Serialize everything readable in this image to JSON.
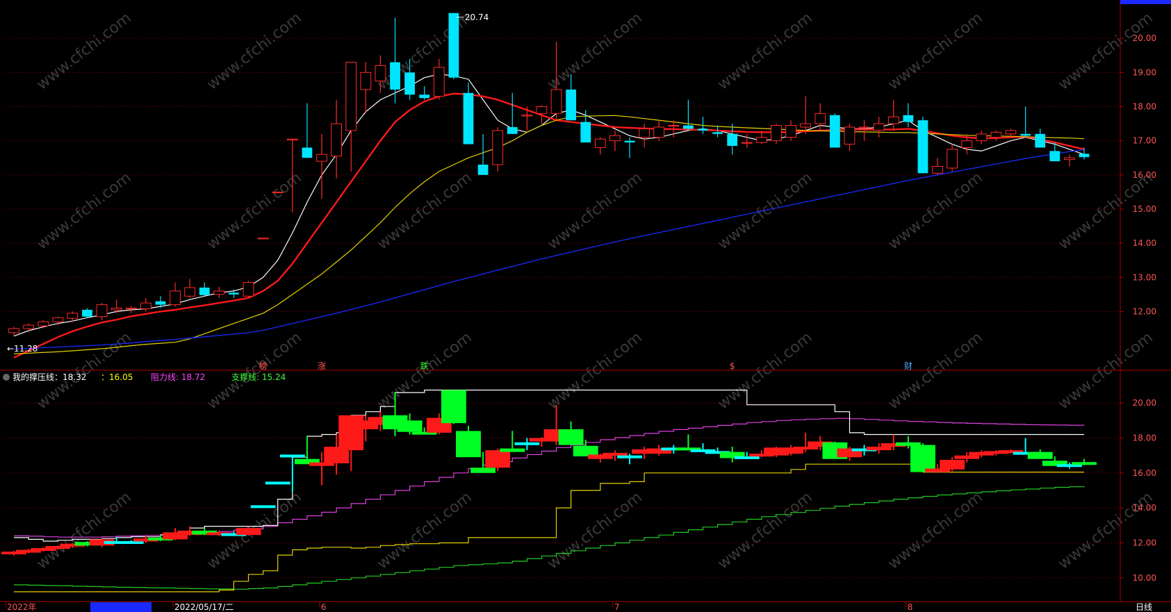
{
  "chart_data": [
    {
      "type": "candlestick",
      "panel": "price",
      "max_label": "20.74",
      "min_label": "11.28",
      "top_right_label": "20.74",
      "y_ticks": [
        "12.00",
        "13.00",
        "14.00",
        "15.00",
        "16.00",
        "17.00",
        "18.00",
        "19.00",
        "20.00"
      ],
      "ylim": [
        10.3,
        21.0
      ],
      "grid": true,
      "colors": {
        "up": "#ff2a2a",
        "down": "#00e5ff",
        "ma5": "#ffffff",
        "ma10": "#ff1a1a",
        "ma20": "#e6d200",
        "ma60": "#1a2aff",
        "grid": "#5a0000",
        "axis": "#aa0000"
      },
      "event_markers": [
        {
          "label": "榜",
          "color": "#ff5555",
          "index": 17
        },
        {
          "label": "涨",
          "color": "#ff5555",
          "index": 21
        },
        {
          "label": "跌",
          "color": "#39ff39",
          "index": 28
        },
        {
          "label": "$",
          "color": "#ff5555",
          "index": 49
        },
        {
          "label": "财",
          "color": "#55aaff",
          "index": 61
        }
      ],
      "candles": [
        [
          11.38,
          11.55,
          11.28,
          11.5
        ],
        [
          11.5,
          11.65,
          11.4,
          11.6
        ],
        [
          11.58,
          11.75,
          11.5,
          11.7
        ],
        [
          11.7,
          11.85,
          11.6,
          11.82
        ],
        [
          11.8,
          12.0,
          11.7,
          11.95
        ],
        [
          12.05,
          12.1,
          11.8,
          11.85
        ],
        [
          11.85,
          12.25,
          11.75,
          12.2
        ],
        [
          12.05,
          12.35,
          11.95,
          12.1
        ],
        [
          12.08,
          12.15,
          11.95,
          12.1
        ],
        [
          12.08,
          12.4,
          12.0,
          12.25
        ],
        [
          12.3,
          12.45,
          12.1,
          12.2
        ],
        [
          12.2,
          12.85,
          12.15,
          12.6
        ],
        [
          12.45,
          12.95,
          12.4,
          12.7
        ],
        [
          12.7,
          12.85,
          12.45,
          12.48
        ],
        [
          12.5,
          12.72,
          12.4,
          12.6
        ],
        [
          12.55,
          12.65,
          12.4,
          12.5
        ],
        [
          12.45,
          12.9,
          12.4,
          12.85
        ],
        [
          14.15,
          14.15,
          14.15,
          14.15
        ],
        [
          15.5,
          15.5,
          15.5,
          15.5
        ],
        [
          17.05,
          17.05,
          14.9,
          17.05
        ],
        [
          16.8,
          18.1,
          16.5,
          16.5
        ],
        [
          16.4,
          17.2,
          15.3,
          16.6
        ],
        [
          16.55,
          18.2,
          15.9,
          17.5
        ],
        [
          17.3,
          19.3,
          16.1,
          19.3
        ],
        [
          18.5,
          19.3,
          17.8,
          19.0
        ],
        [
          18.75,
          19.5,
          18.4,
          19.2
        ],
        [
          19.3,
          20.6,
          18.1,
          18.5
        ],
        [
          19.0,
          19.4,
          18.2,
          18.35
        ],
        [
          18.35,
          18.6,
          18.2,
          18.25
        ],
        [
          18.3,
          19.4,
          18.2,
          19.15
        ],
        [
          20.74,
          20.74,
          18.8,
          18.85
        ],
        [
          18.4,
          18.7,
          16.9,
          16.9
        ],
        [
          16.3,
          17.2,
          16.0,
          16.0
        ],
        [
          16.3,
          17.4,
          16.1,
          17.3
        ],
        [
          17.4,
          18.4,
          17.2,
          17.2
        ],
        [
          17.75,
          18.0,
          17.3,
          17.75
        ],
        [
          17.8,
          18.05,
          17.5,
          18.0
        ],
        [
          17.8,
          19.9,
          17.6,
          18.5
        ],
        [
          18.5,
          18.95,
          17.7,
          17.6
        ],
        [
          17.55,
          17.9,
          17.4,
          16.95
        ],
        [
          16.8,
          17.1,
          16.6,
          17.05
        ],
        [
          17.0,
          17.3,
          16.7,
          17.15
        ],
        [
          17.0,
          17.1,
          16.5,
          16.95
        ],
        [
          17.1,
          17.5,
          16.8,
          17.35
        ],
        [
          17.1,
          17.6,
          17.0,
          17.4
        ],
        [
          17.45,
          17.6,
          17.1,
          17.45
        ],
        [
          17.45,
          18.2,
          17.3,
          17.35
        ],
        [
          17.35,
          17.7,
          17.2,
          17.3
        ],
        [
          17.25,
          17.45,
          17.1,
          17.2
        ],
        [
          17.2,
          17.5,
          16.6,
          16.85
        ],
        [
          16.95,
          17.2,
          16.8,
          16.95
        ],
        [
          16.95,
          17.3,
          16.9,
          17.1
        ],
        [
          17.0,
          17.5,
          16.9,
          17.45
        ],
        [
          17.1,
          17.6,
          17.0,
          17.45
        ],
        [
          17.4,
          18.3,
          17.2,
          17.5
        ],
        [
          17.5,
          18.1,
          17.3,
          17.8
        ],
        [
          17.75,
          17.8,
          16.8,
          16.8
        ],
        [
          16.9,
          17.5,
          16.7,
          17.4
        ],
        [
          17.4,
          17.6,
          17.0,
          17.4
        ],
        [
          17.3,
          17.7,
          17.1,
          17.5
        ],
        [
          17.5,
          18.2,
          17.3,
          17.7
        ],
        [
          17.75,
          18.1,
          17.4,
          17.55
        ],
        [
          17.6,
          17.7,
          16.05,
          16.05
        ],
        [
          16.05,
          16.5,
          16.0,
          16.25
        ],
        [
          16.2,
          16.9,
          16.1,
          16.75
        ],
        [
          16.8,
          17.2,
          16.6,
          17.0
        ],
        [
          17.0,
          17.3,
          16.9,
          17.2
        ],
        [
          17.1,
          17.3,
          17.0,
          17.25
        ],
        [
          17.2,
          17.35,
          17.1,
          17.3
        ],
        [
          17.2,
          18.0,
          17.1,
          17.15
        ],
        [
          17.2,
          17.35,
          16.8,
          16.8
        ],
        [
          16.7,
          16.95,
          16.4,
          16.4
        ],
        [
          16.45,
          16.6,
          16.25,
          16.5
        ],
        [
          16.62,
          16.8,
          16.45,
          16.52
        ]
      ],
      "moving_averages": [
        {
          "name": "MA5",
          "values": [
            11.28,
            11.44,
            11.55,
            11.65,
            11.72,
            11.82,
            11.9,
            12.0,
            12.05,
            12.08,
            12.15,
            12.22,
            12.35,
            12.45,
            12.55,
            12.6,
            12.72,
            13.0,
            13.5,
            14.3,
            15.2,
            16.0,
            16.6,
            17.3,
            17.85,
            18.2,
            18.4,
            18.6,
            18.85,
            18.95,
            18.9,
            18.8,
            18.2,
            17.6,
            17.35,
            17.25,
            17.45,
            17.8,
            17.9,
            17.75,
            17.55,
            17.35,
            17.15,
            17.05,
            17.1,
            17.2,
            17.3,
            17.35,
            17.3,
            17.2,
            17.1,
            17.0,
            17.05,
            17.15,
            17.3,
            17.45,
            17.4,
            17.35,
            17.35,
            17.4,
            17.5,
            17.6,
            17.3,
            17.1,
            16.9,
            16.75,
            16.7,
            16.85,
            17.0,
            17.1,
            17.0,
            16.9,
            16.75,
            16.6
          ]
        },
        {
          "name": "MA10",
          "values": [
            10.65,
            10.85,
            11.05,
            11.25,
            11.42,
            11.56,
            11.68,
            11.76,
            11.86,
            11.93,
            12.0,
            12.05,
            12.12,
            12.18,
            12.25,
            12.32,
            12.4,
            12.6,
            12.9,
            13.4,
            14.0,
            14.6,
            15.2,
            15.8,
            16.4,
            17.0,
            17.55,
            17.9,
            18.15,
            18.3,
            18.38,
            18.36,
            18.3,
            18.2,
            18.05,
            17.9,
            17.75,
            17.6,
            17.55,
            17.5,
            17.45,
            17.4,
            17.38,
            17.36,
            17.35,
            17.34,
            17.33,
            17.32,
            17.3,
            17.28,
            17.26,
            17.25,
            17.25,
            17.26,
            17.28,
            17.3,
            17.32,
            17.33,
            17.33,
            17.33,
            17.33,
            17.35,
            17.3,
            17.22,
            17.15,
            17.1,
            17.07,
            17.08,
            17.1,
            17.12,
            17.05,
            16.95,
            16.85,
            16.75
          ]
        },
        {
          "name": "MA20",
          "values": [
            10.76,
            10.78,
            10.8,
            10.82,
            10.85,
            10.88,
            10.91,
            10.95,
            11.0,
            11.04,
            11.07,
            11.1,
            11.2,
            11.35,
            11.5,
            11.65,
            11.8,
            11.95,
            12.2,
            12.5,
            12.8,
            13.1,
            13.45,
            13.8,
            14.2,
            14.6,
            15.05,
            15.45,
            15.8,
            16.1,
            16.3,
            16.5,
            16.65,
            16.8,
            17.0,
            17.25,
            17.45,
            17.6,
            17.7,
            17.72,
            17.73,
            17.74,
            17.7,
            17.65,
            17.6,
            17.55,
            17.5,
            17.45,
            17.42,
            17.4,
            17.38,
            17.36,
            17.34,
            17.32,
            17.3,
            17.29,
            17.28,
            17.27,
            17.26,
            17.25,
            17.24,
            17.24,
            17.22,
            17.2,
            17.18,
            17.16,
            17.15,
            17.14,
            17.13,
            17.12,
            17.1,
            17.09,
            17.08,
            17.06
          ]
        },
        {
          "name": "MA60",
          "values": [
            10.9,
            10.92,
            10.94,
            10.96,
            10.98,
            11.0,
            11.02,
            11.05,
            11.08,
            11.12,
            11.15,
            11.18,
            11.22,
            11.26,
            11.3,
            11.34,
            11.38,
            11.45,
            11.55,
            11.65,
            11.75,
            11.85,
            11.95,
            12.06,
            12.17,
            12.28,
            12.4,
            12.52,
            12.64,
            12.76,
            12.88,
            12.99,
            13.1,
            13.21,
            13.32,
            13.43,
            13.54,
            13.64,
            13.74,
            13.84,
            13.94,
            14.04,
            14.13,
            14.22,
            14.31,
            14.4,
            14.49,
            14.58,
            14.67,
            14.76,
            14.85,
            14.94,
            15.03,
            15.12,
            15.21,
            15.3,
            15.39,
            15.48,
            15.57,
            15.66,
            15.75,
            15.84,
            15.92,
            16.0,
            16.08,
            16.16,
            16.24,
            16.32,
            16.4,
            16.48,
            16.55,
            16.62,
            16.68,
            16.74
          ]
        }
      ]
    },
    {
      "type": "line",
      "panel": "indicator",
      "indicator_name": "我的撑压线",
      "header": [
        {
          "text": "我的撑压线：18.32",
          "color": "#ffffff"
        },
        {
          "text": "：16.05",
          "color": "#ffff00"
        },
        {
          "text": "阻力线: 18.72",
          "color": "#ff44ff"
        },
        {
          "text": "支撑线: 15.24",
          "color": "#39ff39"
        }
      ],
      "y_ticks": [
        "10.00",
        "12.00",
        "14.00",
        "16.00",
        "18.00",
        "20.00"
      ],
      "ylim": [
        8.8,
        21.0
      ],
      "colors": {
        "upper": "#ffffff",
        "lower": "#e6d200",
        "resistance": "#e040e0",
        "support": "#22cc22",
        "up_bar": "#ff1a1a",
        "down_bar": "#00ff22",
        "flat_bar": "#00ffff"
      },
      "upper_line": [
        12.3,
        12.2,
        12.1,
        12.15,
        12.2,
        12.2,
        12.25,
        12.3,
        12.35,
        12.35,
        12.45,
        12.55,
        12.85,
        12.95,
        12.95,
        12.95,
        12.95,
        13.0,
        14.5,
        16.9,
        18.1,
        18.2,
        18.3,
        19.3,
        19.5,
        19.8,
        20.6,
        20.6,
        20.74,
        20.74,
        20.74,
        20.74,
        20.74,
        20.74,
        20.74,
        20.74,
        20.74,
        20.74,
        20.74,
        20.74,
        20.74,
        20.74,
        20.74,
        20.74,
        20.74,
        20.74,
        20.74,
        20.74,
        20.74,
        20.74,
        19.9,
        19.9,
        19.9,
        19.9,
        19.9,
        19.9,
        19.5,
        18.3,
        18.2,
        18.2,
        18.2,
        18.2,
        18.2,
        18.2,
        18.2,
        18.2,
        18.2,
        18.2,
        18.2,
        18.2,
        18.2,
        18.2,
        18.2,
        18.2
      ],
      "lower_line": [
        9.2,
        9.2,
        9.2,
        9.2,
        9.2,
        9.2,
        9.2,
        9.2,
        9.2,
        9.2,
        9.2,
        9.2,
        9.2,
        9.2,
        9.3,
        9.8,
        10.2,
        10.4,
        11.3,
        11.6,
        11.7,
        11.75,
        11.75,
        11.7,
        11.75,
        11.85,
        11.9,
        11.95,
        11.95,
        12.0,
        12.0,
        12.3,
        12.3,
        12.3,
        12.3,
        12.3,
        12.3,
        14.0,
        15.0,
        15.0,
        15.4,
        15.4,
        15.5,
        16.0,
        16.0,
        16.0,
        16.0,
        16.0,
        16.0,
        16.0,
        16.0,
        16.0,
        16.0,
        16.2,
        16.5,
        16.5,
        16.5,
        16.5,
        16.5,
        16.5,
        16.5,
        16.5,
        16.05,
        16.05,
        16.05,
        16.05,
        16.05,
        16.05,
        16.05,
        16.05,
        16.05,
        16.05,
        16.05,
        16.05
      ],
      "resistance_line": [
        12.4,
        12.38,
        12.35,
        12.33,
        12.33,
        12.33,
        12.35,
        12.38,
        12.4,
        12.43,
        12.47,
        12.5,
        12.55,
        12.6,
        12.65,
        12.72,
        12.8,
        12.95,
        13.15,
        13.35,
        13.55,
        13.75,
        14.0,
        14.25,
        14.5,
        14.75,
        15.0,
        15.25,
        15.5,
        15.75,
        16.0,
        16.25,
        16.45,
        16.65,
        16.85,
        17.05,
        17.25,
        17.45,
        17.6,
        17.75,
        17.9,
        18.02,
        18.14,
        18.26,
        18.38,
        18.48,
        18.56,
        18.64,
        18.72,
        18.8,
        18.88,
        18.94,
        19.0,
        19.04,
        19.08,
        19.1,
        19.12,
        19.1,
        19.06,
        19.02,
        18.98,
        18.95,
        18.92,
        18.89,
        18.86,
        18.84,
        18.82,
        18.8,
        18.78,
        18.76,
        18.75,
        18.74,
        18.73,
        18.72
      ],
      "support_line": [
        9.6,
        9.58,
        9.56,
        9.55,
        9.52,
        9.5,
        9.48,
        9.46,
        9.45,
        9.43,
        9.42,
        9.4,
        9.38,
        9.37,
        9.36,
        9.35,
        9.38,
        9.42,
        9.5,
        9.6,
        9.7,
        9.8,
        9.9,
        10.0,
        10.1,
        10.2,
        10.3,
        10.4,
        10.5,
        10.6,
        10.7,
        10.75,
        10.8,
        10.85,
        10.95,
        11.1,
        11.25,
        11.4,
        11.55,
        11.7,
        11.85,
        12.0,
        12.15,
        12.3,
        12.45,
        12.6,
        12.75,
        12.9,
        13.05,
        13.2,
        13.35,
        13.5,
        13.62,
        13.74,
        13.86,
        13.98,
        14.1,
        14.2,
        14.3,
        14.4,
        14.5,
        14.58,
        14.66,
        14.74,
        14.8,
        14.86,
        14.92,
        14.98,
        15.03,
        15.08,
        15.13,
        15.18,
        15.21,
        15.24
      ]
    }
  ],
  "x_axis": {
    "labels": [
      "2022年",
      "2022/05/17/二",
      "6",
      "7",
      "8"
    ],
    "right_label": "日线"
  },
  "watermark": "www.cfchi.com"
}
